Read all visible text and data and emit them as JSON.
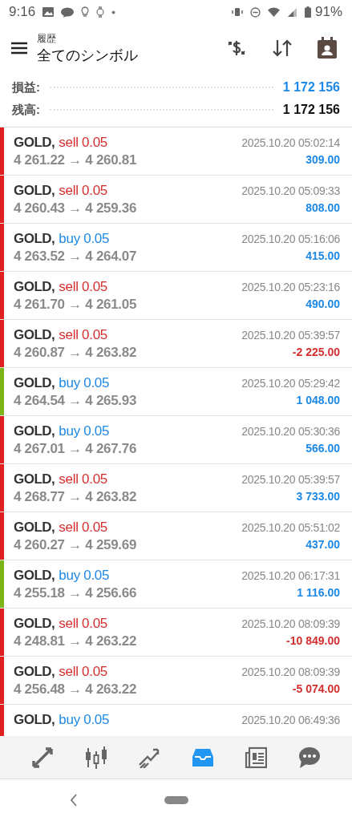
{
  "status_bar": {
    "time": "9:16",
    "battery": "91%"
  },
  "header": {
    "subtitle": "履歴",
    "title": "全てのシンボル"
  },
  "summary": [
    {
      "label": "損益:",
      "value": "1 172 156",
      "highlight": true
    },
    {
      "label": "残高:",
      "value": "1 172 156",
      "highlight": false
    }
  ],
  "deals": [
    {
      "symbol": "GOLD,",
      "kind": "sell",
      "order": "sell 0.05",
      "prices": "4 261.22 → 4 260.81",
      "time": "2025.10.20 05:02:14",
      "profit": "309.00",
      "loss": false,
      "color": "#e02020"
    },
    {
      "symbol": "GOLD,",
      "kind": "sell",
      "order": "sell 0.05",
      "prices": "4 260.43 → 4 259.36",
      "time": "2025.10.20 05:09:33",
      "profit": "808.00",
      "loss": false,
      "color": "#e02020"
    },
    {
      "symbol": "GOLD,",
      "kind": "buy",
      "order": "buy 0.05",
      "prices": "4 263.52 → 4 264.07",
      "time": "2025.10.20 05:16:06",
      "profit": "415.00",
      "loss": false,
      "color": "#e02020"
    },
    {
      "symbol": "GOLD,",
      "kind": "sell",
      "order": "sell 0.05",
      "prices": "4 261.70 → 4 261.05",
      "time": "2025.10.20 05:23:16",
      "profit": "490.00",
      "loss": false,
      "color": "#e02020"
    },
    {
      "symbol": "GOLD,",
      "kind": "sell",
      "order": "sell 0.05",
      "prices": "4 260.87 → 4 263.82",
      "time": "2025.10.20 05:39:57",
      "profit": "-2 225.00",
      "loss": true,
      "color": "#e02020"
    },
    {
      "symbol": "GOLD,",
      "kind": "buy",
      "order": "buy 0.05",
      "prices": "4 264.54 → 4 265.93",
      "time": "2025.10.20 05:29:42",
      "profit": "1 048.00",
      "loss": false,
      "color": "#7cb518"
    },
    {
      "symbol": "GOLD,",
      "kind": "buy",
      "order": "buy 0.05",
      "prices": "4 267.01 → 4 267.76",
      "time": "2025.10.20 05:30:36",
      "profit": "566.00",
      "loss": false,
      "color": "#e02020"
    },
    {
      "symbol": "GOLD,",
      "kind": "sell",
      "order": "sell 0.05",
      "prices": "4 268.77 → 4 263.82",
      "time": "2025.10.20 05:39:57",
      "profit": "3 733.00",
      "loss": false,
      "color": "#e02020"
    },
    {
      "symbol": "GOLD,",
      "kind": "sell",
      "order": "sell 0.05",
      "prices": "4 260.27 → 4 259.69",
      "time": "2025.10.20 05:51:02",
      "profit": "437.00",
      "loss": false,
      "color": "#e02020"
    },
    {
      "symbol": "GOLD,",
      "kind": "buy",
      "order": "buy 0.05",
      "prices": "4 255.18 → 4 256.66",
      "time": "2025.10.20 06:17:31",
      "profit": "1 116.00",
      "loss": false,
      "color": "#7cb518"
    },
    {
      "symbol": "GOLD,",
      "kind": "sell",
      "order": "sell 0.05",
      "prices": "4 248.81 → 4 263.22",
      "time": "2025.10.20 08:09:39",
      "profit": "-10 849.00",
      "loss": true,
      "color": "#e02020"
    },
    {
      "symbol": "GOLD,",
      "kind": "sell",
      "order": "sell 0.05",
      "prices": "4 256.48 → 4 263.22",
      "time": "2025.10.20 08:09:39",
      "profit": "-5 074.00",
      "loss": true,
      "color": "#e02020"
    },
    {
      "symbol": "GOLD,",
      "kind": "buy",
      "order": "buy 0.05",
      "time": "2025.10.20 06:49:36",
      "color": "#e02020"
    }
  ],
  "nav": [
    {
      "kind": "trade",
      "selected": false
    },
    {
      "kind": "chart",
      "selected": false
    },
    {
      "kind": "trend",
      "selected": false
    },
    {
      "kind": "history",
      "selected": true
    },
    {
      "kind": "news",
      "selected": false
    },
    {
      "kind": "chat",
      "selected": false
    }
  ]
}
